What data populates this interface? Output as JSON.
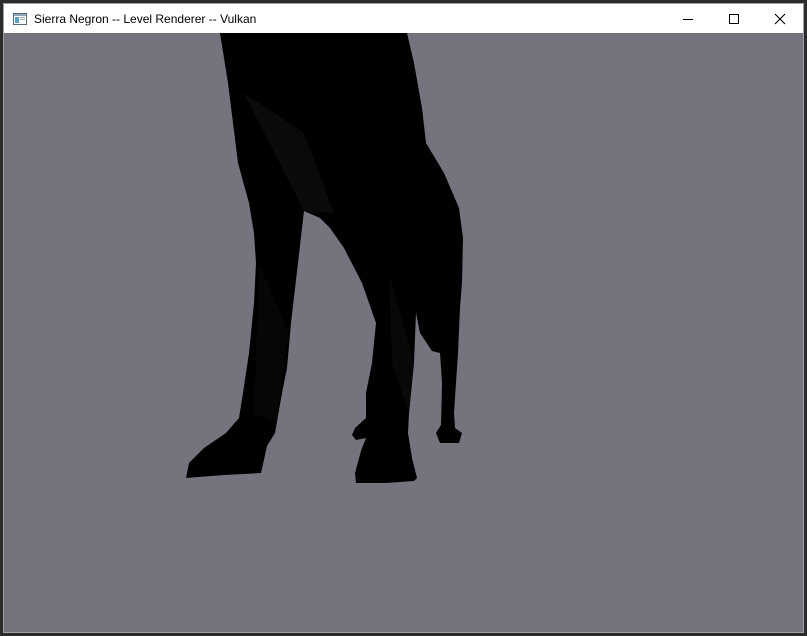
{
  "window": {
    "title": "Sierra Negron -- Level Renderer -- Vulkan",
    "icon": "app-window-icon",
    "controls": {
      "minimize": "minimize-icon",
      "maximize": "maximize-icon",
      "close": "close-icon"
    }
  },
  "viewport": {
    "background_color": "#74747f",
    "model_color": "#000000",
    "content": "black silhouette of animal legs"
  }
}
